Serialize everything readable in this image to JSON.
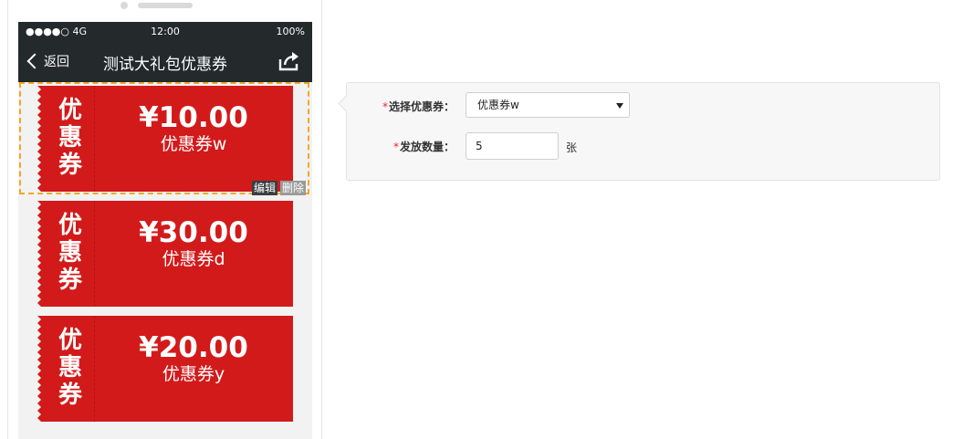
{
  "statusbar": {
    "signal": "●●●●○ 4G",
    "time": "12:00",
    "battery": "100%"
  },
  "navbar": {
    "back_label": "返回",
    "title": "测试大礼包优惠券"
  },
  "coupon_side_glyphs": [
    "优",
    "惠",
    "券"
  ],
  "coupons": [
    {
      "price": "¥10.00",
      "name": "优惠券w"
    },
    {
      "price": "¥30.00",
      "name": "优惠券d"
    },
    {
      "price": "¥20.00",
      "name": "优惠券y"
    }
  ],
  "selection_tools": {
    "edit_label": "编辑",
    "delete_label": "删除"
  },
  "form": {
    "required_mark": "*",
    "coupon_label": "选择优惠券：",
    "coupon_value": "优惠券w",
    "quantity_label": "发放数量：",
    "quantity_value": "5",
    "quantity_unit": "张"
  },
  "colors": {
    "coupon_red": "#d21a1a",
    "nav_dark": "#24292b",
    "selection": "#f5a623"
  }
}
